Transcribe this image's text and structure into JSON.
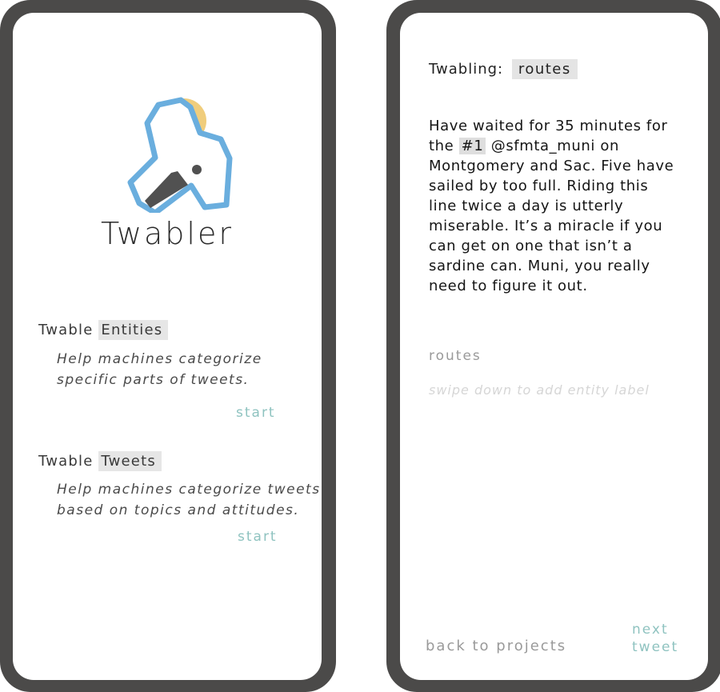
{
  "home": {
    "app_name": "Twabler",
    "entities": {
      "prefix": "Twable",
      "highlight": "Entities",
      "description_line1": "Help machines categorize",
      "description_line2": "specific parts of tweets.",
      "start_label": "start"
    },
    "tweets": {
      "prefix": "Twable",
      "highlight": "Tweets",
      "description_line1": "Help machines categorize tweets",
      "description_line2": "based on topics and attitudes.",
      "start_label": "start"
    }
  },
  "labeling": {
    "title_prefix": "Twabling:",
    "current_tag": "routes",
    "tweet": {
      "before_hashtag": "Have waited for 35 minutes for the ",
      "hashtag": "#1",
      "after_hashtag": " @sfmta_muni on Montgomery and Sac. Five have sailed by too full. Riding this line twice a day is utterly miserable. It’s a miracle if you can get on one that isn’t a sardine can. Muni, you really need to figure it out."
    },
    "entity_label": "routes",
    "hint": "swipe down to add entity label",
    "back_label": "back to projects",
    "next_line1": "next",
    "next_line2": "tweet"
  },
  "colors": {
    "phone_frame": "#4b4a49",
    "accent_teal": "#8fc3c0",
    "logo_blue": "#6aaede",
    "logo_sun": "#f0cd7c",
    "highlight_gray": "#e6e6e6"
  },
  "icons": {
    "logo": "twabler-logo-icon"
  }
}
